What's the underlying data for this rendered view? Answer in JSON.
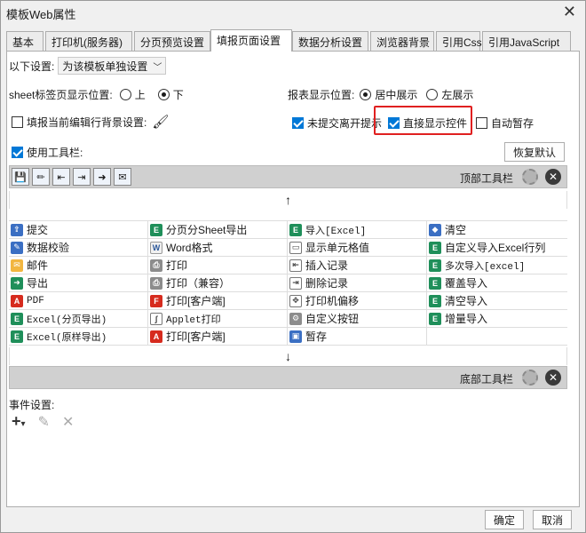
{
  "window": {
    "title": "模板Web属性",
    "close": "✕"
  },
  "tabs": [
    "基本",
    "打印机(服务器)",
    "分页预览设置",
    "填报页面设置",
    "数据分析设置",
    "浏览器背景",
    "引用Css",
    "引用JavaScript"
  ],
  "active_tab": 3,
  "settings": {
    "scope_label": "以下设置:",
    "scope_value": "为该模板单独设置",
    "sheet_pos_label": "sheet标签页显示位置:",
    "sheet_pos_options": [
      "上",
      "下"
    ],
    "sheet_pos_selected": "下",
    "report_pos_label": "报表显示位置:",
    "report_pos_options": [
      "居中展示",
      "左展示"
    ],
    "report_pos_selected": "居中展示",
    "fill_bg_label": "填报当前编辑行背景设置:",
    "fill_bg_checked": false,
    "unsubmitted_label": "未提交离开提示",
    "unsubmitted_checked": true,
    "direct_control_label": "直接显示控件",
    "direct_control_checked": true,
    "autosave_label": "自动暂存",
    "autosave_checked": false,
    "use_toolbar_label": "使用工具栏:",
    "use_toolbar_checked": true,
    "restore_default": "恢复默认"
  },
  "top_toolbar": {
    "label": "顶部工具栏",
    "icons": [
      "save-icon",
      "validate-icon",
      "insert-row-icon",
      "delete-row-icon",
      "export-icon",
      "email-icon"
    ]
  },
  "bottom_toolbar": {
    "label": "底部工具栏"
  },
  "buttons_grid": [
    [
      {
        "label": "提交",
        "icon": "blue"
      },
      {
        "label": "分页分Sheet导出",
        "icon": "green"
      },
      {
        "label": "导入[Excel]",
        "icon": "green"
      },
      {
        "label": "清空",
        "icon": "blue"
      }
    ],
    [
      {
        "label": "数据校验",
        "icon": "blue"
      },
      {
        "label": "Word格式",
        "icon": "word"
      },
      {
        "label": "显示单元格值",
        "icon": "line"
      },
      {
        "label": "自定义导入Excel行列",
        "icon": "green"
      }
    ],
    [
      {
        "label": "邮件",
        "icon": "mail"
      },
      {
        "label": "打印",
        "icon": "gray"
      },
      {
        "label": "插入记录",
        "icon": "line"
      },
      {
        "label": "多次导入[excel]",
        "icon": "green"
      }
    ],
    [
      {
        "label": "导出",
        "icon": "green"
      },
      {
        "label": "打印（兼容）",
        "icon": "gray"
      },
      {
        "label": "删除记录",
        "icon": "line"
      },
      {
        "label": "覆盖导入",
        "icon": "green"
      }
    ],
    [
      {
        "label": "PDF",
        "icon": "pdf"
      },
      {
        "label": "打印[客户端]",
        "icon": "pdf"
      },
      {
        "label": "打印机偏移",
        "icon": "line"
      },
      {
        "label": "清空导入",
        "icon": "green"
      }
    ],
    [
      {
        "label": "Excel(分页导出)",
        "icon": "green"
      },
      {
        "label": "Applet打印",
        "icon": "line"
      },
      {
        "label": "自定义按钮",
        "icon": "gray"
      },
      {
        "label": "增量导入",
        "icon": "green"
      }
    ],
    [
      {
        "label": "Excel(原样导出)",
        "icon": "green"
      },
      {
        "label": "打印[客户端]",
        "icon": "pdf"
      },
      {
        "label": "暂存",
        "icon": "blue"
      },
      {
        "label": "",
        "icon": ""
      }
    ]
  ],
  "events": {
    "label": "事件设置:",
    "add": "+",
    "add_dropdown": "▾",
    "edit": "✎",
    "delete": "✕"
  },
  "footer": {
    "ok": "确定",
    "cancel": "取消"
  },
  "colors": {
    "accent": "#0078d7",
    "highlight": "#e02020"
  }
}
